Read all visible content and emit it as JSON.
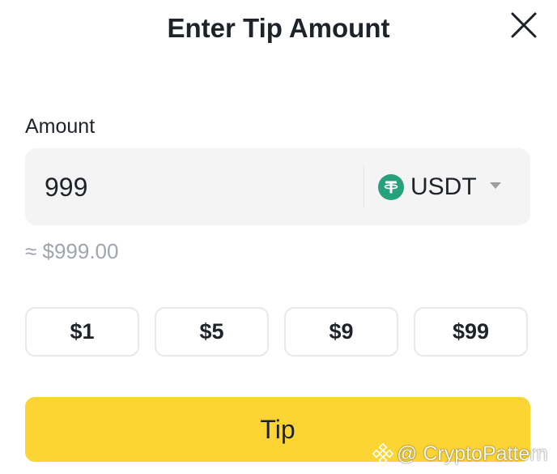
{
  "dialog": {
    "title": "Enter Tip Amount",
    "close_icon": "close-icon"
  },
  "amount": {
    "label": "Amount",
    "value": "999",
    "currency": "USDT",
    "currency_icon": "tether-icon",
    "dropdown_icon": "caret-down-icon",
    "approx_value": "≈ $999.00"
  },
  "presets": [
    "$1",
    "$5",
    "$9",
    "$99"
  ],
  "tip_button": {
    "label": "Tip"
  },
  "watermark": {
    "text": "@ CryptoPattern",
    "icon": "binance-logo-icon"
  },
  "colors": {
    "accent": "#fcd535",
    "input_bg": "#f4f4f4",
    "text": "#1e2329",
    "muted": "#a0a5ad",
    "usdt": "#26a17b"
  }
}
